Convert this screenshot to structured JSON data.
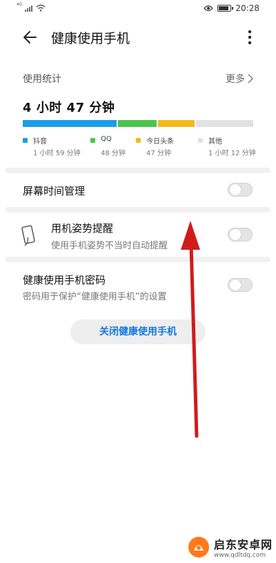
{
  "status_bar": {
    "network": "4G",
    "time": "20:28"
  },
  "app_bar": {
    "title": "健康使用手机"
  },
  "usage": {
    "label": "使用统计",
    "more_label": "更多",
    "total": "4 小时 47 分钟",
    "apps": [
      {
        "name": "抖音",
        "time": "1 小时 59 分钟",
        "minutes": 119,
        "color": "#1a9ee6"
      },
      {
        "name": "QQ",
        "time": "48 分钟",
        "minutes": 48,
        "color": "#4bc44e"
      },
      {
        "name": "今日头条",
        "time": "47 分钟",
        "minutes": 47,
        "color": "#f2b91a"
      },
      {
        "name": "其他",
        "time": "1 小时 12 分钟",
        "minutes": 72,
        "color": "#e2e2e2"
      }
    ]
  },
  "settings": {
    "screen_time": {
      "title": "屏幕时间管理",
      "enabled": false
    },
    "posture": {
      "title": "用机姿势提醒",
      "subtitle": "使用手机姿势不当时自动提醒",
      "enabled": false
    },
    "password": {
      "title": "健康使用手机密码",
      "subtitle": "密码用于保护“健康使用手机”的设置",
      "enabled": false
    }
  },
  "close_button": {
    "label": "关闭健康使用手机"
  },
  "watermark": {
    "title": "启东安卓网",
    "url": "www.qdltdq.com"
  },
  "annotation": {
    "arrow_color": "#d31a1a"
  }
}
